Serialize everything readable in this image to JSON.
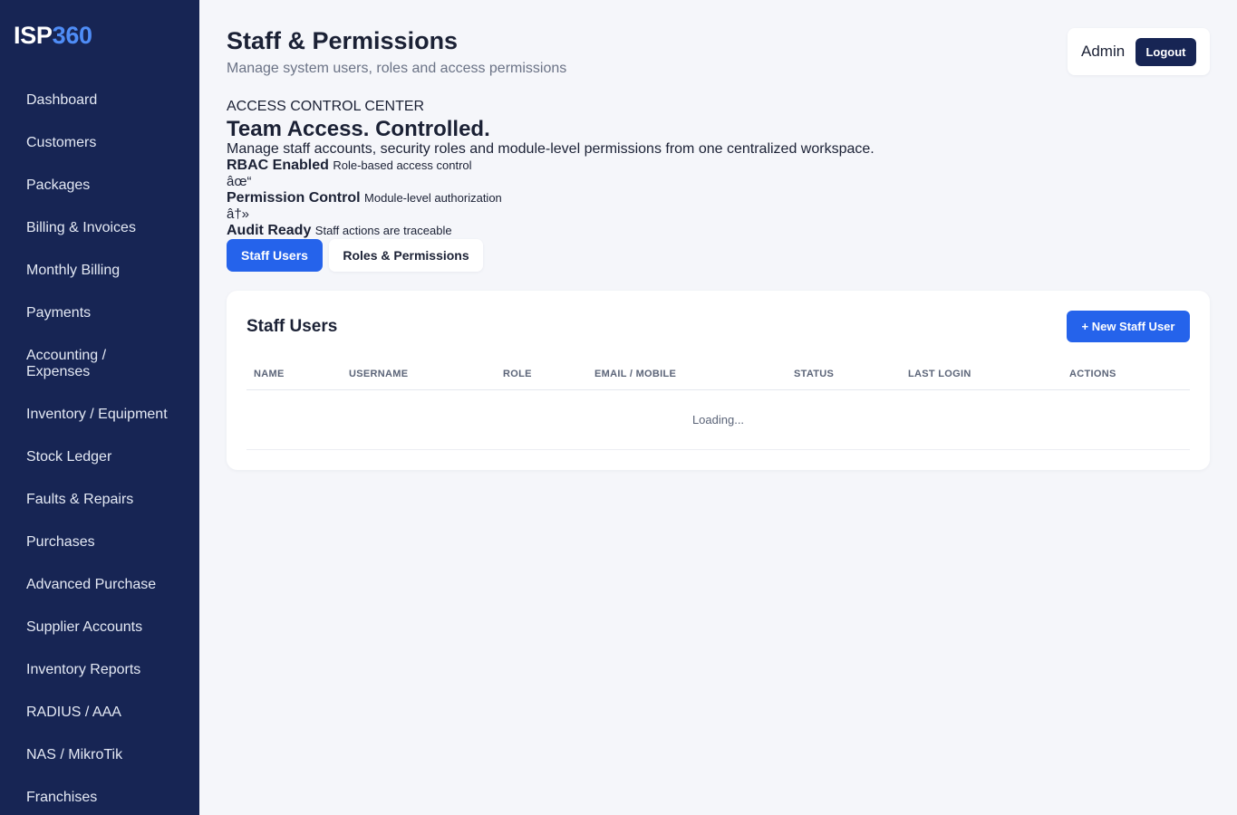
{
  "brand": {
    "prefix": "ISP",
    "suffix": "360"
  },
  "sidebar": {
    "items": [
      {
        "label": "Dashboard"
      },
      {
        "label": "Customers"
      },
      {
        "label": "Packages"
      },
      {
        "label": "Billing & Invoices"
      },
      {
        "label": "Monthly Billing"
      },
      {
        "label": "Payments"
      },
      {
        "label": "Accounting /\nExpenses"
      },
      {
        "label": "Inventory / Equipment"
      },
      {
        "label": "Stock Ledger"
      },
      {
        "label": "Faults & Repairs"
      },
      {
        "label": "Purchases"
      },
      {
        "label": "Advanced Purchase"
      },
      {
        "label": "Supplier Accounts"
      },
      {
        "label": "Inventory Reports"
      },
      {
        "label": "RADIUS / AAA"
      },
      {
        "label": "NAS / MikroTik"
      },
      {
        "label": "Franchises"
      }
    ]
  },
  "header": {
    "title": "Staff & Permissions",
    "subtitle": "Manage system users, roles and access permissions",
    "user_name": "Admin",
    "logout_label": "Logout"
  },
  "hero": {
    "eyebrow": "ACCESS CONTROL CENTER",
    "title": "Team Access. Controlled.",
    "description": "Manage staff accounts, security roles and module-level permissions from one centralized workspace.",
    "features": [
      {
        "title": "RBAC Enabled",
        "desc": "Role-based access control",
        "glyph": "âœ“"
      },
      {
        "title": "Permission Control",
        "desc": "Module-level authorization",
        "glyph": "â†»"
      },
      {
        "title": "Audit Ready",
        "desc": "Staff actions are traceable"
      }
    ]
  },
  "tabs": [
    {
      "label": "Staff Users",
      "active": true
    },
    {
      "label": "Roles & Permissions",
      "active": false
    }
  ],
  "card": {
    "title": "Staff Users",
    "new_button_label": "+ New Staff User",
    "columns": [
      "NAME",
      "USERNAME",
      "ROLE",
      "EMAIL / MOBILE",
      "STATUS",
      "LAST LOGIN",
      "ACTIONS"
    ],
    "loading_text": "Loading..."
  },
  "colors": {
    "sidebar_bg": "#172554",
    "primary": "#2563eb",
    "brand_accent": "#4f8df7",
    "page_bg": "#f5f6fa"
  }
}
